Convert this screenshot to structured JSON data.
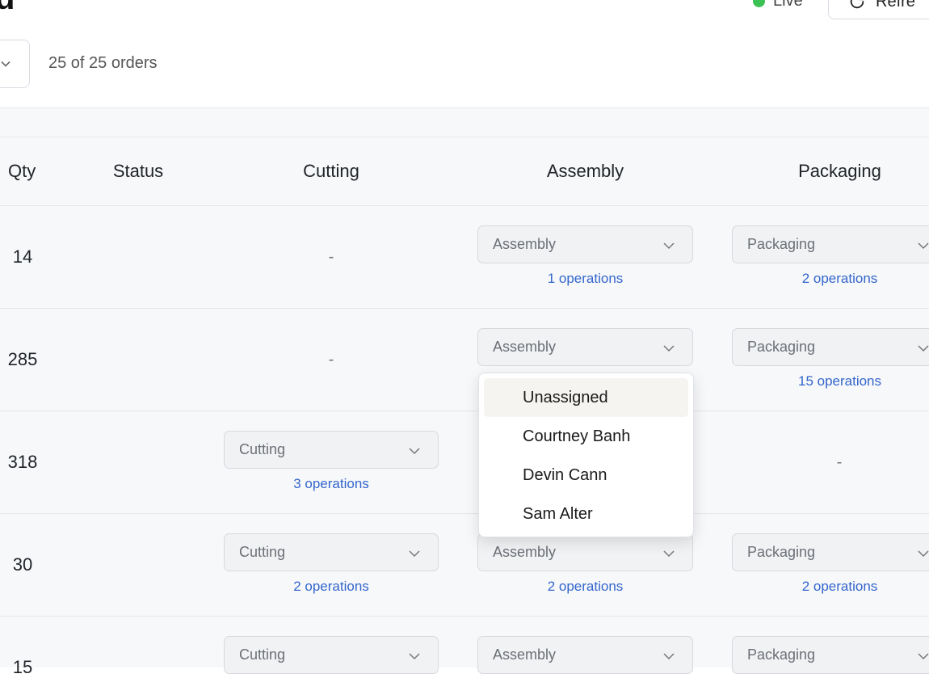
{
  "header": {
    "title_fragment": "d",
    "live_label": "Live",
    "refresh_label": "Refre"
  },
  "filters": {
    "order_count_text": "25 of 25 orders"
  },
  "table": {
    "columns": [
      "Qty",
      "Status",
      "Cutting",
      "Assembly",
      "Packaging"
    ],
    "rows": [
      {
        "qty": "14",
        "cutting": {
          "empty": "-"
        },
        "assembly": {
          "value": "Assembly",
          "ops": "1 operations"
        },
        "packaging": {
          "value": "Packaging",
          "ops": "2 operations"
        }
      },
      {
        "qty": "285",
        "cutting": {
          "empty": "-"
        },
        "assembly": {
          "value": "Assembly"
        },
        "packaging": {
          "value": "Packaging",
          "ops": "15 operations"
        }
      },
      {
        "qty": "318",
        "cutting": {
          "value": "Cutting",
          "ops": "3 operations"
        },
        "packaging": {
          "empty": "-"
        }
      },
      {
        "qty": "30",
        "cutting": {
          "value": "Cutting",
          "ops": "2 operations"
        },
        "assembly": {
          "value": "Assembly",
          "ops": "2 operations"
        },
        "packaging": {
          "value": "Packaging",
          "ops": "2 operations"
        }
      },
      {
        "qty": "15",
        "cutting": {
          "value": "Cutting"
        },
        "assembly": {
          "value": "Assembly"
        },
        "packaging": {
          "value": "Packaging"
        }
      }
    ]
  },
  "assignee_dropdown": {
    "highlighted": "Unassigned",
    "options": [
      "Unassigned",
      "Courtney Banh",
      "Devin Cann",
      "Sam Alter"
    ]
  },
  "colors": {
    "live_dot": "#3cc154",
    "operations_link": "#3366cc",
    "table_background": "#f7f8fa"
  }
}
